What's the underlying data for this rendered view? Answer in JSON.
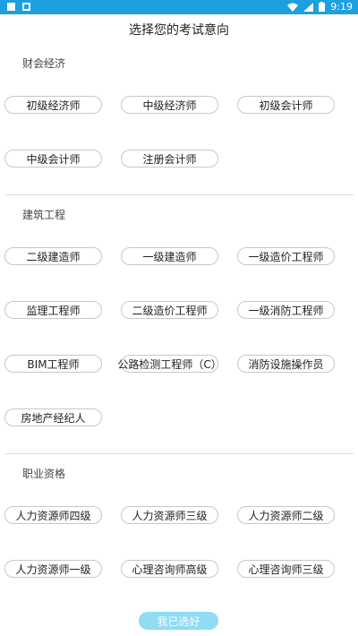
{
  "status_bar": {
    "time": "9:19"
  },
  "page_title": "选择您的考试意向",
  "sections": [
    {
      "label": "财会经济",
      "items": [
        "初级经济师",
        "中级经济师",
        "初级会计师",
        "中级会计师",
        "注册会计师"
      ]
    },
    {
      "label": "建筑工程",
      "items": [
        "二级建造师",
        "一级建造师",
        "一级造价工程师",
        "监理工程师",
        "二级造价工程师",
        "一级消防工程师",
        "BIM工程师",
        "公路检测工程师（C）",
        "消防设施操作员",
        "房地产经纪人"
      ]
    },
    {
      "label": "职业资格",
      "items": [
        "人力资源师四级",
        "人力资源师三级",
        "人力资源师二级",
        "人力资源师一级",
        "心理咨询师高级",
        "心理咨询师三级"
      ]
    }
  ],
  "confirm_button": "我已选好",
  "colors": {
    "status_bar": "#1e9fe0",
    "confirm_button": "#8fdcf3",
    "chip_border": "#c8c8c8"
  }
}
